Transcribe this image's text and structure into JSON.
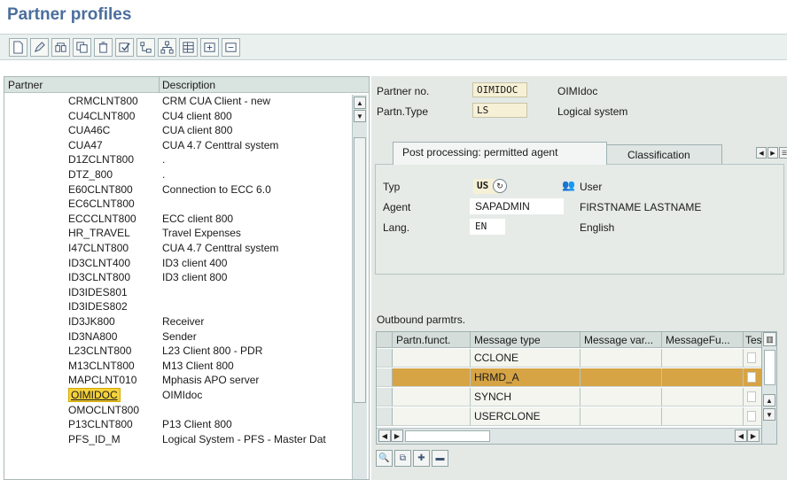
{
  "window": {
    "title": "Partner profiles"
  },
  "toolbar": {
    "buttons": [
      "new-icon",
      "edit-icon",
      "display-icon",
      "copy-icon",
      "delete-icon",
      "check-icon",
      "tree-icon",
      "hierarchy-icon",
      "table-icon",
      "expand-icon",
      "collapse-icon"
    ]
  },
  "tree": {
    "columns": {
      "partner": "Partner",
      "description": "Description"
    },
    "rows": [
      {
        "partner": "CRMCLNT800",
        "description": "CRM CUA Client - new"
      },
      {
        "partner": "CU4CLNT800",
        "description": "CU4 client 800"
      },
      {
        "partner": "CUA46C",
        "description": "CUA client 800"
      },
      {
        "partner": "CUA47",
        "description": "CUA 4.7 Centtral system"
      },
      {
        "partner": "D1ZCLNT800",
        "description": "."
      },
      {
        "partner": "DTZ_800",
        "description": "."
      },
      {
        "partner": "E60CLNT800",
        "description": "Connection to ECC 6.0"
      },
      {
        "partner": "EC6CLNT800",
        "description": ""
      },
      {
        "partner": "ECCCLNT800",
        "description": "ECC client 800"
      },
      {
        "partner": "HR_TRAVEL",
        "description": "Travel Expenses"
      },
      {
        "partner": "I47CLNT800",
        "description": "CUA 4.7 Centtral system"
      },
      {
        "partner": "ID3CLNT400",
        "description": "ID3 client 400"
      },
      {
        "partner": "ID3CLNT800",
        "description": "ID3 client 800"
      },
      {
        "partner": "ID3IDES801",
        "description": ""
      },
      {
        "partner": "ID3IDES802",
        "description": ""
      },
      {
        "partner": "ID3JK800",
        "description": "Receiver"
      },
      {
        "partner": "ID3NA800",
        "description": "Sender"
      },
      {
        "partner": "L23CLNT800",
        "description": "L23 Client 800 - PDR"
      },
      {
        "partner": "M13CLNT800",
        "description": "M13 Client 800"
      },
      {
        "partner": "MAPCLNT010",
        "description": "Mphasis APO server"
      },
      {
        "partner": "OIMIDOC",
        "description": "OIMIdoc",
        "selected": true
      },
      {
        "partner": "OMOCLNT800",
        "description": ""
      },
      {
        "partner": "P13CLNT800",
        "description": "P13 Client 800"
      },
      {
        "partner": "PFS_ID_M",
        "description": "Logical System - PFS - Master Dat"
      }
    ]
  },
  "header": {
    "partner_no_label": "Partner no.",
    "partner_no_value": "OIMIDOC",
    "partner_no_desc": "OIMIdoc",
    "partner_type_label": "Partn.Type",
    "partner_type_value": "LS",
    "partner_type_desc": "Logical system"
  },
  "tabs": {
    "post_processing": "Post processing: permitted agent",
    "classification": "Classification"
  },
  "agent": {
    "typ_label": "Typ",
    "typ_value": "US",
    "typ_desc": "User",
    "agent_label": "Agent",
    "agent_value": "SAPADMIN",
    "agent_desc": "FIRSTNAME LASTNAME",
    "lang_label": "Lang.",
    "lang_value": "EN",
    "lang_desc": "English"
  },
  "outbound": {
    "title": "Outbound parmtrs.",
    "columns": [
      "Partn.funct.",
      "Message type",
      "Message var...",
      "MessageFu...",
      "Tes"
    ],
    "rows": [
      {
        "partn_funct": "",
        "message_type": "CCLONE",
        "message_var": "",
        "message_fu": ""
      },
      {
        "partn_funct": "",
        "message_type": "HRMD_A",
        "message_var": "",
        "message_fu": "",
        "highlight": true
      },
      {
        "partn_funct": "",
        "message_type": "SYNCH",
        "message_var": "",
        "message_fu": ""
      },
      {
        "partn_funct": "",
        "message_type": "USERCLONE",
        "message_var": "",
        "message_fu": ""
      }
    ]
  },
  "colors": {
    "title": "#4b6e9c",
    "highlight_row": "#d6a445",
    "selected_node": "#f5d23a",
    "panel_bg": "#e4e9e6"
  }
}
